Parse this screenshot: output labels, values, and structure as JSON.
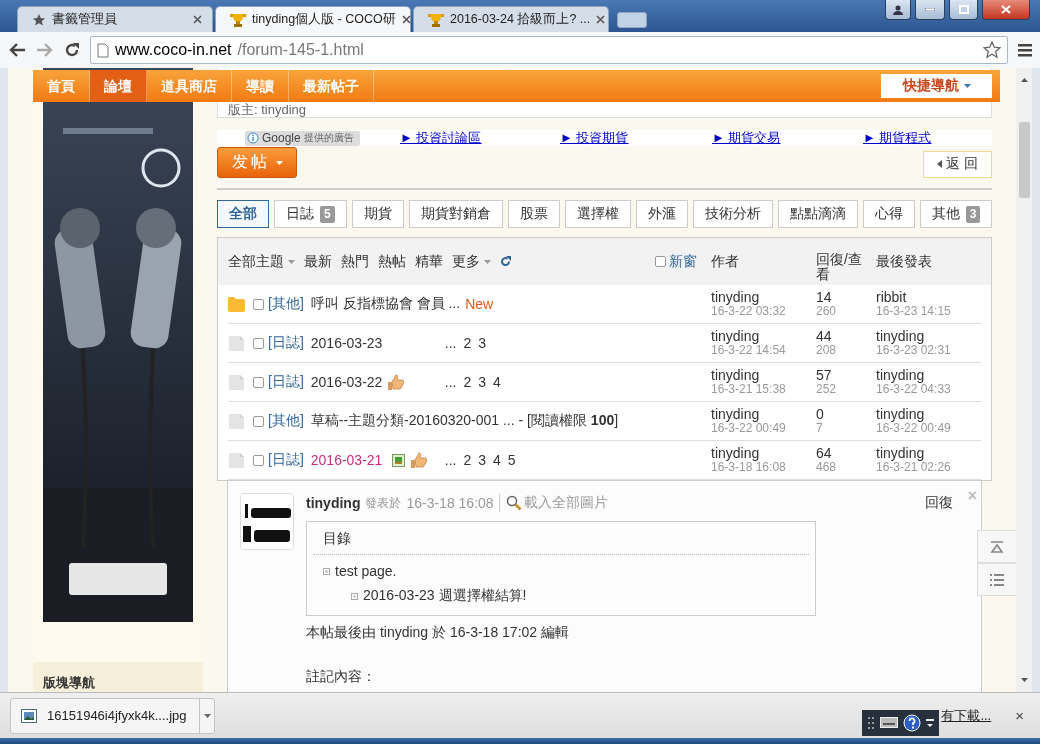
{
  "browser": {
    "tabs": [
      {
        "title": "書籤管理員",
        "kind": "bookmarks",
        "selected": false
      },
      {
        "title": "tinyding個人版 - COCO研",
        "kind": "site",
        "selected": true
      },
      {
        "title": "2016-03-24 拾級而上? ...",
        "kind": "site",
        "selected": false
      }
    ],
    "address": {
      "host": "www.coco-in.net",
      "path": "/forum-145-1.html"
    }
  },
  "site_nav": {
    "items": [
      {
        "label": "首頁",
        "selected": false
      },
      {
        "label": "論壇",
        "selected": true
      },
      {
        "label": "道具商店",
        "selected": false
      },
      {
        "label": "導讀",
        "selected": false
      },
      {
        "label": "最新帖子",
        "selected": false
      }
    ],
    "quick_nav": "快捷導航"
  },
  "sidebar": {
    "section_title": "版塊導航"
  },
  "forum_header": {
    "moderator": "版主: tinyding"
  },
  "ads": {
    "provider": "Google",
    "provider_note": "提供的廣告",
    "links": [
      "► 投資討論區",
      "► 投資期貨",
      "► 期貨交易",
      "► 期貨程式"
    ]
  },
  "actions": {
    "post": "发帖",
    "back": "返 回"
  },
  "category_tabs": [
    {
      "label": "全部",
      "selected": true
    },
    {
      "label": "日誌",
      "count": "5",
      "selected": false
    },
    {
      "label": "期貨",
      "selected": false
    },
    {
      "label": "期貨對銷倉",
      "selected": false
    },
    {
      "label": "股票",
      "selected": false
    },
    {
      "label": "選擇權",
      "selected": false
    },
    {
      "label": "外滙",
      "selected": false
    },
    {
      "label": "技術分析",
      "selected": false
    },
    {
      "label": "點點滴滴",
      "selected": false
    },
    {
      "label": "心得",
      "selected": false
    },
    {
      "label": "其他",
      "count": "3",
      "selected": false
    }
  ],
  "thread_list": {
    "filters": [
      {
        "label": "全部主題",
        "dropdown": true
      },
      {
        "label": "最新",
        "dropdown": false
      },
      {
        "label": "熱門",
        "dropdown": false
      },
      {
        "label": "熱帖",
        "dropdown": false
      },
      {
        "label": "精華",
        "dropdown": false
      },
      {
        "label": "更多",
        "dropdown": true
      }
    ],
    "new_window": {
      "label": "新窗",
      "checked": false
    },
    "columns": [
      "作者",
      "回復/查看",
      "最後發表"
    ],
    "rows": [
      {
        "kind": "new",
        "checked": false,
        "category": "[其他]",
        "title": "呼叫 反指標協會 會員 ...",
        "highlight": false,
        "image_icon": false,
        "thumb_icon": false,
        "badge": "New",
        "author": "tinyding",
        "posted": "16-3-22 03:32",
        "replies": "14",
        "views": "260",
        "last_poster": "ribbit",
        "last_time": "16-3-23 14:15"
      },
      {
        "kind": "plain",
        "checked": false,
        "category": "[日誌]",
        "title": "2016-03-23",
        "highlight": false,
        "image_icon": false,
        "thumb_icon": false,
        "page_prefix": "...",
        "pages": [
          "2",
          "3"
        ],
        "author": "tinyding",
        "posted": "16-3-22 14:54",
        "replies": "44",
        "views": "208",
        "last_poster": "tinyding",
        "last_time": "16-3-23 02:31"
      },
      {
        "kind": "plain",
        "checked": false,
        "category": "[日誌]",
        "title": "2016-03-22",
        "highlight": false,
        "image_icon": false,
        "thumb_icon": true,
        "page_prefix": "...",
        "pages": [
          "2",
          "3",
          "4"
        ],
        "author": "tinyding",
        "posted": "16-3-21 15:38",
        "replies": "57",
        "views": "252",
        "last_poster": "tinyding",
        "last_time": "16-3-22 04:33"
      },
      {
        "kind": "plain",
        "checked": false,
        "category": "[其他]",
        "title": "草稿--主題分類-20160320-001 ... - [閱讀權限 **100**]",
        "highlight": false,
        "image_icon": false,
        "thumb_icon": false,
        "author": "tinyding",
        "posted": "16-3-22 00:49",
        "replies": "0",
        "views": "7",
        "last_poster": "tinyding",
        "last_time": "16-3-22 00:49"
      },
      {
        "kind": "plain",
        "checked": false,
        "category": "[日誌]",
        "title": "2016-03-21",
        "highlight": true,
        "image_icon": true,
        "thumb_icon": true,
        "page_prefix": "...",
        "pages": [
          "2",
          "3",
          "4",
          "5"
        ],
        "author": "tinyding",
        "posted": "16-3-18 16:08",
        "replies": "64",
        "views": "468",
        "last_poster": "tinyding",
        "last_time": "16-3-21 02:26"
      }
    ]
  },
  "post_preview": {
    "author": "tinyding",
    "posted_label": "發表於",
    "posted_time": "16-3-18 16:08",
    "load_images": "載入全部圖片",
    "reply": "回復",
    "close": "×",
    "toc": {
      "title": "目錄",
      "items": [
        {
          "text": "test page.",
          "children": [
            {
              "text": "2016-03-23 週選擇權結算!"
            }
          ]
        }
      ]
    },
    "edit_note": "本帖最後由 tinyding 於 16-3-18 17:02 編輯",
    "body_start": "註記內容："
  },
  "downloads": {
    "file": "16151946i4jfyxk4k....jpg",
    "show_all": "有下載...",
    "close": "×"
  }
}
